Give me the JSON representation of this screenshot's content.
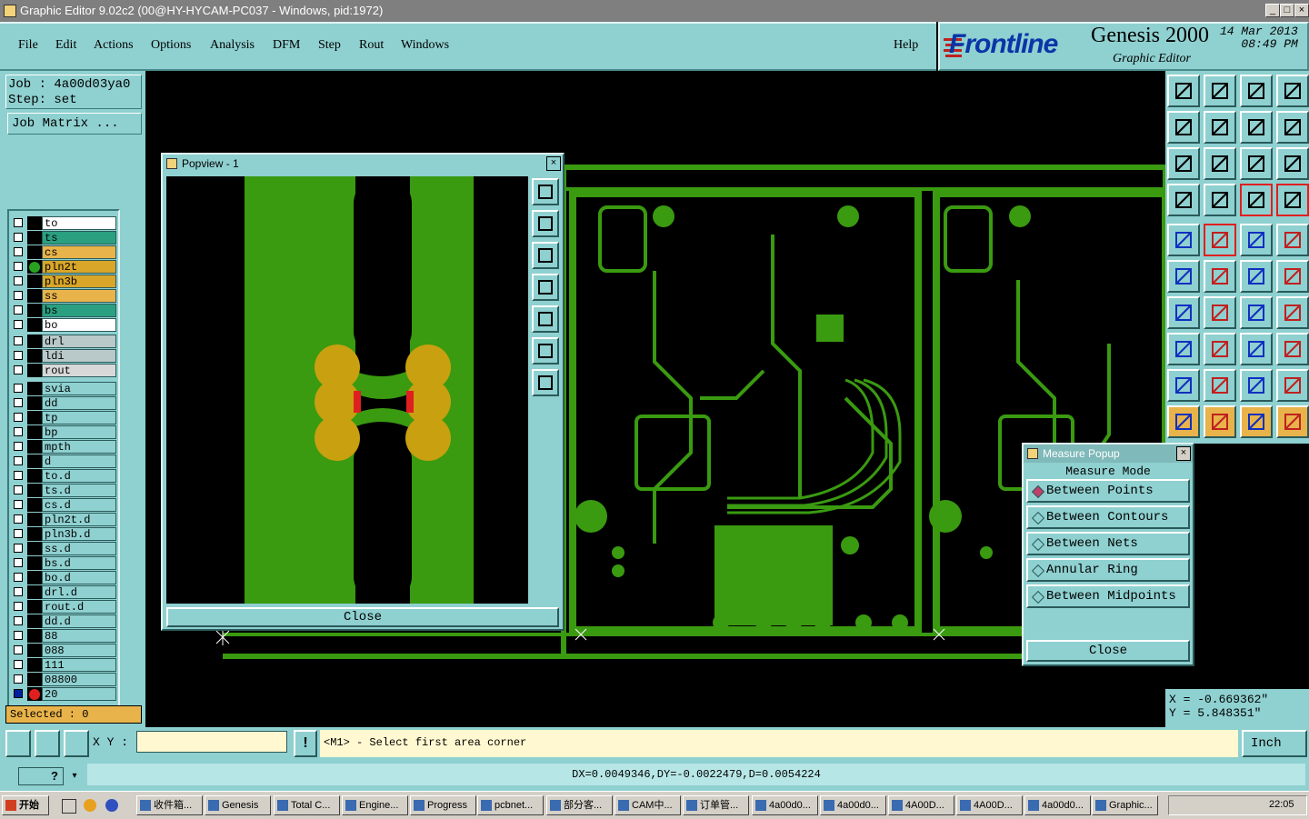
{
  "window": {
    "title": "Graphic Editor 9.02c2 (00@HY-HYCAM-PC037 - Windows, pid:1972)"
  },
  "menu": [
    "File",
    "Edit",
    "Actions",
    "Options",
    "Analysis",
    "DFM",
    "Step",
    "Rout",
    "Windows"
  ],
  "help_label": "Help",
  "brand": {
    "logo": "Frontline",
    "product": "Genesis 2000",
    "subtitle": "Graphic Editor",
    "date": "14 Mar 2013",
    "time": "08:49 PM"
  },
  "left": {
    "job": "Job : 4a00d03ya0",
    "step": "Step: set",
    "job_matrix": "Job Matrix ...",
    "selected": "Selected : 0"
  },
  "layers": [
    {
      "name": "to",
      "color": "#ffffff"
    },
    {
      "name": "ts",
      "color": "#2aa080"
    },
    {
      "name": "cs",
      "color": "#e8b34a"
    },
    {
      "name": "pln2t",
      "color": "#d9a62a",
      "dot": "#2aa020"
    },
    {
      "name": "pln3b",
      "color": "#d9a62a"
    },
    {
      "name": "ss",
      "color": "#e8b34a"
    },
    {
      "name": "bs",
      "color": "#2aa080"
    },
    {
      "name": "bo",
      "color": "#ffffff"
    },
    {
      "name": "drl",
      "color": "#b9c9c9"
    },
    {
      "name": "ldi",
      "color": "#b9c9c9"
    },
    {
      "name": "rout",
      "color": "#d8d8d8"
    },
    {
      "name": "svia",
      "color": "#8fd0d0"
    },
    {
      "name": "dd",
      "color": "#8fd0d0"
    },
    {
      "name": "tp",
      "color": "#8fd0d0"
    },
    {
      "name": "bp",
      "color": "#8fd0d0"
    },
    {
      "name": "mpth",
      "color": "#8fd0d0"
    },
    {
      "name": "d",
      "color": "#8fd0d0"
    },
    {
      "name": "to.d",
      "color": "#8fd0d0"
    },
    {
      "name": "ts.d",
      "color": "#8fd0d0"
    },
    {
      "name": "cs.d",
      "color": "#8fd0d0"
    },
    {
      "name": "pln2t.d",
      "color": "#8fd0d0"
    },
    {
      "name": "pln3b.d",
      "color": "#8fd0d0"
    },
    {
      "name": "ss.d",
      "color": "#8fd0d0"
    },
    {
      "name": "bs.d",
      "color": "#8fd0d0"
    },
    {
      "name": "bo.d",
      "color": "#8fd0d0"
    },
    {
      "name": "drl.d",
      "color": "#8fd0d0"
    },
    {
      "name": "rout.d",
      "color": "#8fd0d0"
    },
    {
      "name": "dd.d",
      "color": "#8fd0d0"
    },
    {
      "name": "88",
      "color": "#8fd0d0"
    },
    {
      "name": "088",
      "color": "#8fd0d0"
    },
    {
      "name": "111",
      "color": "#8fd0d0"
    },
    {
      "name": "08800",
      "color": "#8fd0d0"
    },
    {
      "name": "20",
      "color": "#8fd0d0",
      "dot": "#e02020"
    }
  ],
  "popview": {
    "title": "Popview - 1",
    "close": "Close"
  },
  "measure": {
    "title": "Measure Popup",
    "header": "Measure Mode",
    "options": [
      "Between Points",
      "Between Contours",
      "Between Nets",
      "Annular Ring",
      "Between Midpoints"
    ],
    "selected": "Between Points",
    "close": "Close"
  },
  "coords": {
    "x": "X = -0.669362\"",
    "y": "Y = 5.848351\""
  },
  "command": {
    "xy_label": "X Y :",
    "xy_value": "",
    "prompt": "<M1> - Select first area corner",
    "unit": "Inch"
  },
  "status": "DX=0.0049346,DY=-0.0022479,D=0.0054224",
  "taskbar": {
    "start": "开始",
    "tasks": [
      "收件箱...",
      "Genesis",
      "Total C...",
      "Engine...",
      "Progress",
      "pcbnet...",
      "部分客...",
      "CAM中...",
      "订单管...",
      "4a00d0...",
      "4a00d0...",
      "4A00D...",
      "4A00D...",
      "4a00d0...",
      "Graphic..."
    ],
    "clock": "22:05"
  },
  "colors": {
    "panel": "#8fd0d0",
    "copper": "#3a9a10",
    "pad": "#c8a010",
    "highlight": "#e8b34a",
    "marker": "#e02020"
  }
}
